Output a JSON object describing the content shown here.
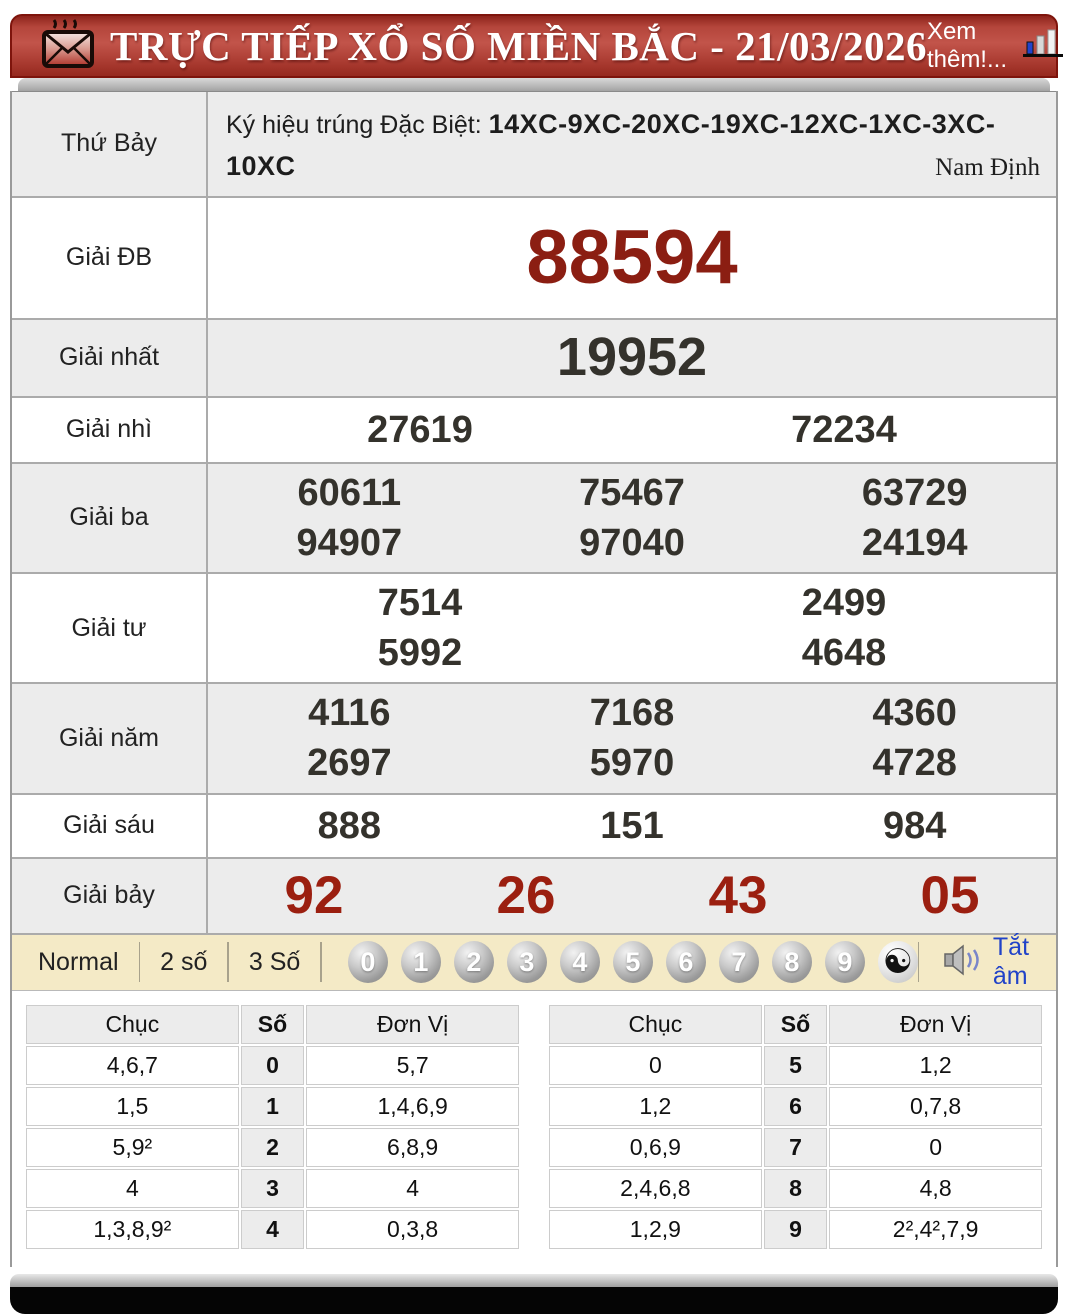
{
  "header": {
    "title": "TRỰC TIẾP XỔ SỐ MIỀN BẮC - 21/03/2026",
    "more_link": "Xem thêm!..."
  },
  "results": {
    "day_label": "Thứ Bảy",
    "symbol_prefix": "Ký hiệu trúng Đặc Biệt: ",
    "symbol_codes": "14XC-9XC-20XC-19XC-12XC-1XC-3XC-10XC",
    "province": "Nam Định",
    "rows": [
      {
        "label": "Giải ĐB",
        "lines": [
          [
            "88594"
          ]
        ]
      },
      {
        "label": "Giải nhất",
        "lines": [
          [
            "19952"
          ]
        ]
      },
      {
        "label": "Giải nhì",
        "lines": [
          [
            "27619",
            "72234"
          ]
        ]
      },
      {
        "label": "Giải ba",
        "lines": [
          [
            "60611",
            "75467",
            "63729"
          ],
          [
            "94907",
            "97040",
            "24194"
          ]
        ]
      },
      {
        "label": "Giải tư",
        "lines": [
          [
            "7514",
            "2499"
          ],
          [
            "5992",
            "4648"
          ]
        ]
      },
      {
        "label": "Giải năm",
        "lines": [
          [
            "4116",
            "7168",
            "4360"
          ],
          [
            "2697",
            "5970",
            "4728"
          ]
        ]
      },
      {
        "label": "Giải sáu",
        "lines": [
          [
            "888",
            "151",
            "984"
          ]
        ]
      },
      {
        "label": "Giải bảy",
        "lines": [
          [
            "92",
            "26",
            "43",
            "05"
          ]
        ]
      }
    ]
  },
  "toolbar": {
    "modes": [
      "Normal",
      "2 số",
      "3 Số"
    ],
    "balls": [
      "0",
      "1",
      "2",
      "3",
      "4",
      "5",
      "6",
      "7",
      "8",
      "9"
    ],
    "yinyang": "☯",
    "mute_label": "Tắt âm"
  },
  "stats": {
    "headers": {
      "chuc": "Chục",
      "so": "Số",
      "donvi": "Đơn Vị"
    },
    "left": [
      {
        "chuc": "4,6,7",
        "so": "0",
        "donvi": "5,7"
      },
      {
        "chuc": "1,5",
        "so": "1",
        "donvi": "1,4,6,9"
      },
      {
        "chuc": "5,9²",
        "so": "2",
        "donvi": "6,8,9"
      },
      {
        "chuc": "4",
        "so": "3",
        "donvi": "4"
      },
      {
        "chuc": "1,3,8,9²",
        "so": "4",
        "donvi": "0,3,8"
      }
    ],
    "right": [
      {
        "chuc": "0",
        "so": "5",
        "donvi": "1,2"
      },
      {
        "chuc": "1,2",
        "so": "6",
        "donvi": "0,7,8"
      },
      {
        "chuc": "0,6,9",
        "so": "7",
        "donvi": "0"
      },
      {
        "chuc": "2,4,6,8",
        "so": "8",
        "donvi": "4,8"
      },
      {
        "chuc": "1,2,9",
        "so": "9",
        "donvi": "2²,4²,7,9"
      }
    ]
  },
  "colors": {
    "header_red": "#b4453b",
    "special_number_red": "#8b1e12",
    "seventh_prize_red": "#9b1f10",
    "toolbar_beige": "#f4eac6",
    "mute_link_blue": "#2143c8",
    "number_dark": "#34322c"
  }
}
